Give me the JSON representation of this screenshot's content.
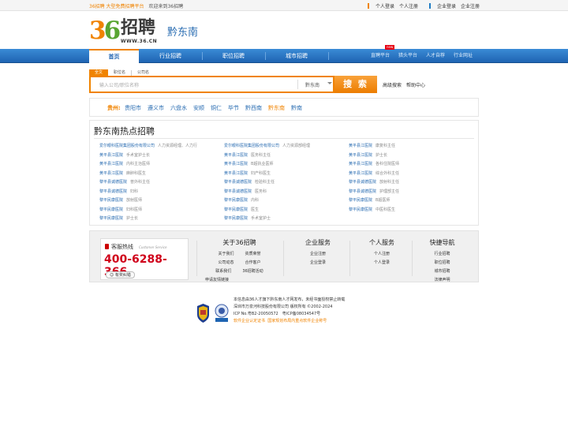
{
  "topbar": {
    "brand": "36招聘 大型免费招聘平台",
    "welcome": "欢迎来到36招聘",
    "person_login": "个人登录",
    "person_register": "个人注册",
    "company_login": "企业登录",
    "company_register": "企业注册"
  },
  "logo": {
    "num": "36",
    "zhaopin": "招聘",
    "url": "WWW.36.CN"
  },
  "city": "黔东南",
  "nav": {
    "home": "首页",
    "items": [
      "行业招聘",
      "职位招聘",
      "城市招聘"
    ],
    "right": [
      "直聘平台",
      "猎头平台",
      "人才自荐",
      "行业网址"
    ],
    "new_badge": "new"
  },
  "search": {
    "tabs": [
      "全文",
      "职位名",
      "公司名"
    ],
    "placeholder": "输入公司/职位名称",
    "city": "黔东南",
    "button": "搜 索",
    "advanced": "高级搜索",
    "help": "帮助中心"
  },
  "province": {
    "label": "贵州:",
    "cities": [
      "贵阳市",
      "遵义市",
      "六盘水",
      "安顺",
      "铜仁",
      "毕节",
      "黔西南",
      "黔东南",
      "黔南"
    ],
    "current": "黔东南"
  },
  "hot": {
    "title": "黔东南热点招聘",
    "rows": [
      [
        [
          "爱尔眼科医院集团股份有限公司",
          "人力资源经理、人力行"
        ],
        [
          "爱尔眼科医院集团股份有限公司",
          "人力资源部经理"
        ],
        [
          "黄平县江医院",
          "康复科主任"
        ]
      ],
      [
        [
          "黄平县江医院",
          "手术室护士长"
        ],
        [
          "黄平县江医院",
          "医务科主任"
        ],
        [
          "黄平县江医院",
          "护士长"
        ]
      ],
      [
        [
          "黄平县江医院",
          "内科主治医师"
        ],
        [
          "黄平县江医院",
          "B超执业医师"
        ],
        [
          "黄平县江医院",
          "各科住院医师"
        ]
      ],
      [
        [
          "黄平县江医院",
          "麻醉科医生"
        ],
        [
          "黄平县江医院",
          "妇产科医生"
        ],
        [
          "黄平县江医院",
          "综合外科主任"
        ]
      ],
      [
        [
          "黎平县诚德医院",
          "普外科主任"
        ],
        [
          "黎平县诚德医院",
          "检验科主任"
        ],
        [
          "黎平县诚德医院",
          "放射科主任"
        ]
      ],
      [
        [
          "黎平县诚德医院",
          "妇科"
        ],
        [
          "黎平县诚德医院",
          "医务科"
        ],
        [
          "黎平县诚德医院",
          "护理部主任"
        ]
      ],
      [
        [
          "黎平民康医院",
          "放射医师"
        ],
        [
          "黎平民康医院",
          "内科"
        ],
        [
          "黎平民康医院",
          "B超医师"
        ]
      ],
      [
        [
          "黎平民康医院",
          "妇科医师"
        ],
        [
          "黎平民康医院",
          "医生"
        ],
        [
          "黎平民康医院",
          "中医科医生"
        ]
      ],
      [
        [
          "黎平民康医院",
          "护士长"
        ],
        [
          "黎平民康医院",
          "手术室护士"
        ]
      ]
    ]
  },
  "footer": {
    "hotline_title": "客服热线",
    "hotline_en": "Customer Service",
    "hotline_num": "400-6288-366",
    "feedback": "有奖纠错",
    "about": {
      "title": "关于36招聘",
      "links": [
        [
          "关于我们",
          "资质荣誉"
        ],
        [
          "公司动态",
          "合作客户"
        ],
        [
          "联系我们",
          "36招聘活动"
        ]
      ],
      "last": "申请友情链接"
    },
    "company": {
      "title": "企业服务",
      "links": [
        "企业注册",
        "企业登录"
      ]
    },
    "person": {
      "title": "个人服务",
      "links": [
        "个人注册",
        "个人登录"
      ]
    },
    "quick": {
      "title": "快捷导航",
      "links": [
        "行业招聘",
        "职位招聘",
        "城市招聘",
        "法律声明"
      ]
    }
  },
  "copyright": {
    "l1": "本信息由36人才旗下黔东南人才网发布，未经书面授权禁止转载",
    "l2": "深圳市万泉河科技股份有限公司 版权所有 ©2002-2024",
    "l3": "ICP No.粤B2-20050572　粤ICP备08034547号",
    "l4a": "软件企业认定证书",
    "l4b": "国家规划布局内重点软件企业称号"
  }
}
